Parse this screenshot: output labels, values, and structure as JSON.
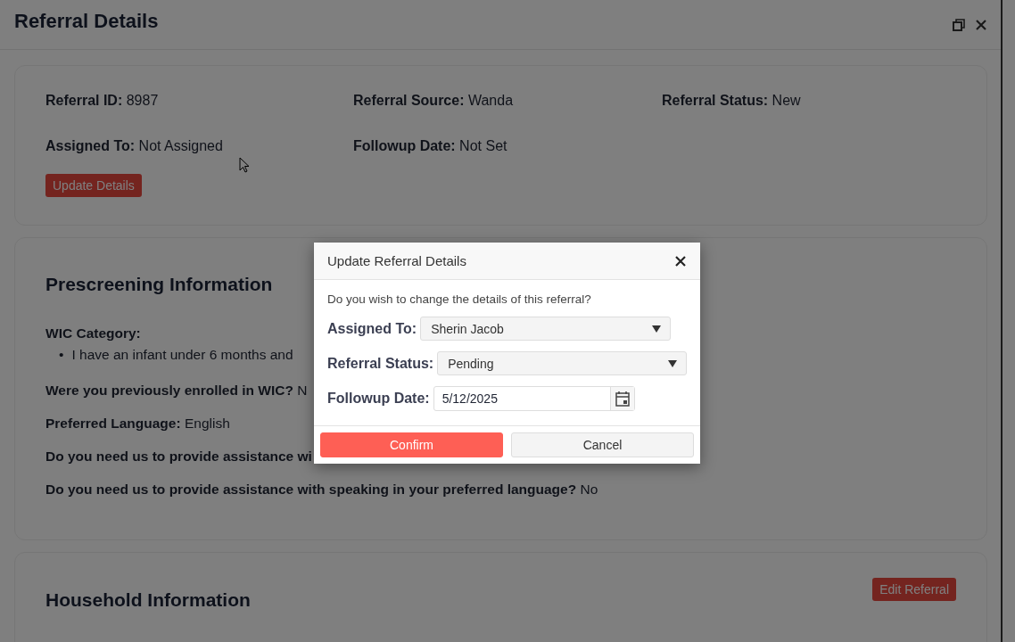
{
  "window": {
    "title": "Referral Details"
  },
  "summary": {
    "fields": [
      {
        "label": "Referral ID:",
        "value": "8987"
      },
      {
        "label": "Referral Source:",
        "value": "Wanda"
      },
      {
        "label": "Referral Status:",
        "value": "New"
      },
      {
        "label": "Assigned To:",
        "value": "Not Assigned"
      },
      {
        "label": "Followup Date:",
        "value": "Not Set"
      }
    ],
    "button": "Update Details"
  },
  "prescreening": {
    "title": "Prescreening Information",
    "category_label": "WIC Category:",
    "categories": [
      {
        "marker": "•",
        "text": "I have an infant under 6 months and"
      }
    ],
    "answers": [
      {
        "label": "Were you previously enrolled in WIC?",
        "value": "N"
      },
      {
        "label": "Preferred Language:",
        "value": "English"
      },
      {
        "label": "Do you need us to provide assistance wi"
      },
      {
        "label": "Do you need us to provide assistance with speaking in your preferred language?",
        "value": "No"
      }
    ]
  },
  "household": {
    "title": "Household Information",
    "button": "Edit Referral"
  },
  "dialog": {
    "title": "Update Referral Details",
    "message": "Do you wish to change the details of this referral?",
    "fields": [
      {
        "kind": "select",
        "label": "Assigned To:",
        "value": "Sherin Jacob"
      },
      {
        "kind": "select",
        "label": "Referral Status:",
        "value": "Pending"
      },
      {
        "kind": "date",
        "label": "Followup Date:",
        "value": "5/12/2025"
      }
    ],
    "buttons": [
      {
        "kind": "primary",
        "label": "Confirm"
      },
      {
        "kind": "secondary",
        "label": "Cancel"
      }
    ]
  }
}
